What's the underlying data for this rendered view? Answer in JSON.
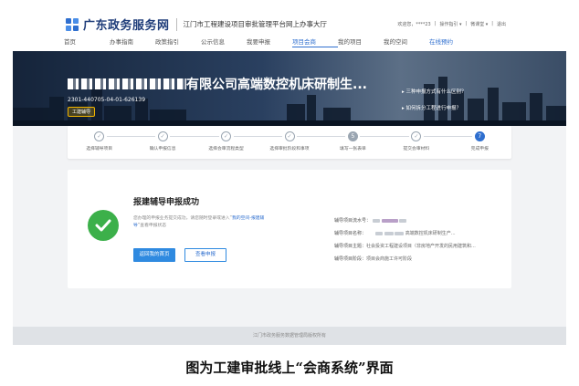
{
  "header": {
    "brand": "广东政务服务网",
    "subtitle": "江门市工程建设项目审批管理平台网上办事大厅",
    "userbar": [
      "欢迎您，****23",
      "|",
      "操作指引 ▾",
      "|",
      "微课堂 ▾",
      "|",
      "退出"
    ]
  },
  "nav": [
    {
      "label": "首页",
      "state": "normal"
    },
    {
      "label": "办事指南",
      "state": "normal"
    },
    {
      "label": "政策指引",
      "state": "normal"
    },
    {
      "label": "公示信息",
      "state": "normal"
    },
    {
      "label": "我要申报",
      "state": "normal"
    },
    {
      "label": "项目会商",
      "state": "active"
    },
    {
      "label": "我的项目",
      "state": "normal"
    },
    {
      "label": "我的空间",
      "state": "normal"
    },
    {
      "label": "在线预约",
      "state": "alt"
    }
  ],
  "banner": {
    "project_name": "有限公司高端数控机床研制生...",
    "project_code": "2301-440705-04-01-626139",
    "tag": "工建辅导",
    "faq": [
      "三种申报方式有什么区别？",
      "如何拆分工程进行申报？"
    ]
  },
  "steps": [
    {
      "label": "选择辅导项目",
      "mark": "✓",
      "state": "done"
    },
    {
      "label": "确认申报信息",
      "mark": "✓",
      "state": "done"
    },
    {
      "label": "选择会审流程类型",
      "mark": "✓",
      "state": "done"
    },
    {
      "label": "选择审批阶段和事项",
      "mark": "✓",
      "state": "done"
    },
    {
      "label": "填写一张表单",
      "mark": "5",
      "state": "num"
    },
    {
      "label": "提交会审材料",
      "mark": "✓",
      "state": "done"
    },
    {
      "label": "完成申报",
      "mark": "7",
      "state": "current"
    }
  ],
  "result": {
    "title": "报建辅导申报成功",
    "desc_1": "您办理的申报业务提交成功，请您随时登录或进入“",
    "desc_link": "我的空间-报建辅导",
    "desc_2": "”查看申报状态",
    "btn_back": "返回我的首页",
    "btn_view": "查看申报",
    "fields": [
      {
        "label": "辅导项目流水号：",
        "value": ""
      },
      {
        "label": "辅导项目名称：",
        "value": "高端数控机床研制生产..."
      },
      {
        "label": "辅导项目主题：",
        "value": "社会投资工程建设项目（非房地产开发的民用建筑和..."
      },
      {
        "label": "辅导项目阶段：",
        "value": "项目会商施工许可阶段"
      }
    ]
  },
  "footer": "江门市政务服务数据管理局版权所有",
  "caption": "图为工建审批线上“会商系统”界面",
  "colors": {
    "accent": "#2f6fcf",
    "success": "#3cb04a",
    "banner_dark": "#15243a"
  }
}
